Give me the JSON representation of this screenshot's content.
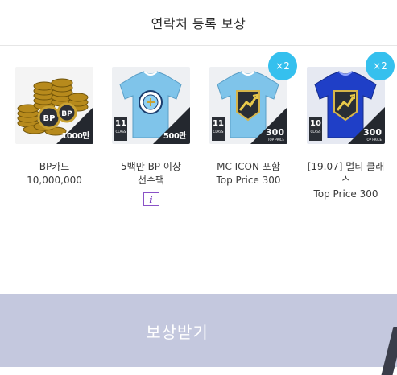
{
  "header": {
    "title": "연락처 등록 보상"
  },
  "rewards": [
    {
      "name": "BP카드",
      "sub": "10,000,000",
      "amount_label": "1000만",
      "icon": "bp-coins-icon"
    },
    {
      "name": "5백만 BP 이상",
      "sub": "선수팩",
      "amount_label": "500만",
      "ovr": "11",
      "ovr_class": "CLASS",
      "info_label": "i",
      "icon": "manchester-city-shirt-icon"
    },
    {
      "name": "MC ICON 포함",
      "sub": "Top Price 300",
      "badge": "×2",
      "ovr": "11",
      "ovr_class": "CLASS",
      "price": "300",
      "price_label": "TOP PRICE",
      "icon": "mc-icon-shirt-icon"
    },
    {
      "name": "[19.07] 멀티 클래스",
      "sub": "Top Price 300",
      "badge": "×2",
      "ovr": "10",
      "ovr_class": "CLASS",
      "price": "300",
      "price_label": "TOP PRICE",
      "icon": "multi-class-shirt-icon"
    }
  ],
  "claim_button": {
    "label": "보상받기"
  },
  "colors": {
    "accent_badge": "#35c0ee",
    "button_bg": "#c4c8de",
    "info_icon": "#7a3fbf"
  }
}
